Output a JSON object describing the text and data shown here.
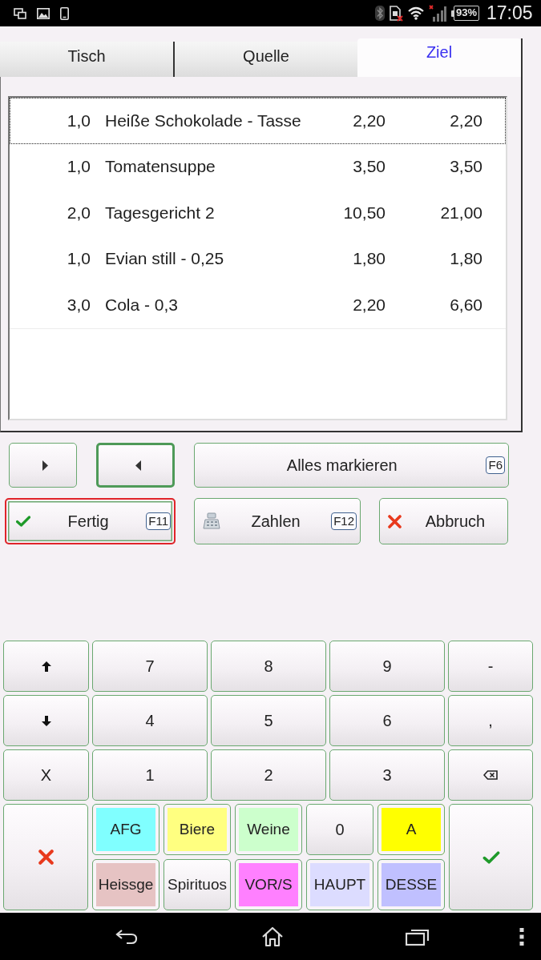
{
  "status_bar": {
    "battery": "93%",
    "time": "17:05"
  },
  "tabs": [
    {
      "label": "Tisch",
      "selected": false
    },
    {
      "label": "Quelle",
      "selected": false
    },
    {
      "label": "Ziel",
      "selected": true
    }
  ],
  "table": {
    "rows": [
      {
        "quantity": "1,0",
        "item": "Heiße Schokolade - Tasse",
        "price": "2,20",
        "total": "2,20",
        "selected": true
      },
      {
        "quantity": "1,0",
        "item": "Tomatensuppe",
        "price": "3,50",
        "total": "3,50",
        "selected": false
      },
      {
        "quantity": "2,0",
        "item": "Tagesgericht 2",
        "price": "10,50",
        "total": "21,00",
        "selected": false
      },
      {
        "quantity": "1,0",
        "item": "Evian still - 0,25",
        "price": "1,80",
        "total": "1,80",
        "selected": false
      },
      {
        "quantity": "3,0",
        "item": "Cola - 0,3",
        "price": "2,20",
        "total": "6,60",
        "selected": false
      }
    ]
  },
  "action_rows": [
    {
      "buttons": [
        {
          "kind": "forward",
          "active": false,
          "focused": false
        },
        {
          "kind": "back",
          "active": true,
          "focused": false
        },
        {
          "kind": "select_all",
          "label": "Alles markieren",
          "shortcut": "F6",
          "active": false,
          "focused": false
        }
      ]
    },
    {
      "buttons": [
        {
          "kind": "done",
          "label": "Fertig",
          "shortcut": "F11",
          "active": false,
          "focused": true
        },
        {
          "kind": "pay",
          "label": "Zahlen",
          "shortcut": "F12",
          "active": false,
          "focused": false
        },
        {
          "kind": "cancel",
          "label": "Abbruch",
          "active": false,
          "focused": false
        }
      ]
    }
  ],
  "keypad": {
    "keys": [
      {
        "kind": "up"
      },
      {
        "kind": "digit",
        "label": "7"
      },
      {
        "kind": "digit",
        "label": "8"
      },
      {
        "kind": "digit",
        "label": "9"
      },
      {
        "kind": "symbol",
        "label": "-"
      },
      {
        "kind": "down"
      },
      {
        "kind": "digit",
        "label": "4"
      },
      {
        "kind": "digit",
        "label": "5"
      },
      {
        "kind": "digit",
        "label": "6"
      },
      {
        "kind": "symbol",
        "label": ","
      },
      {
        "kind": "symbol",
        "label": "X"
      },
      {
        "kind": "digit",
        "label": "1"
      },
      {
        "kind": "digit",
        "label": "2"
      },
      {
        "kind": "digit",
        "label": "3"
      },
      {
        "kind": "backspace"
      }
    ],
    "quick_keys": [
      {
        "kind": "cancel"
      },
      {
        "kind": "category",
        "label": "AFG",
        "color": "#80ffff"
      },
      {
        "kind": "category",
        "label": "Biere",
        "color": "#ffff80"
      },
      {
        "kind": "category",
        "label": "Weine",
        "color": "#ccffcc"
      },
      {
        "kind": "digit",
        "label": "0"
      },
      {
        "kind": "category",
        "label": "A",
        "color": "#ffff00"
      },
      {
        "kind": "confirm"
      },
      {
        "kind": "category",
        "label": "Heissge",
        "color": "#e6c3c3"
      },
      {
        "kind": "category",
        "label": "Spirituos"
      },
      {
        "kind": "category",
        "label": "VOR/S",
        "color": "#ff80ff"
      },
      {
        "kind": "category",
        "label": "HAUPT",
        "color": "#dcdcff"
      },
      {
        "kind": "category",
        "label": "DESSE",
        "color": "#c0c0ff"
      }
    ]
  }
}
